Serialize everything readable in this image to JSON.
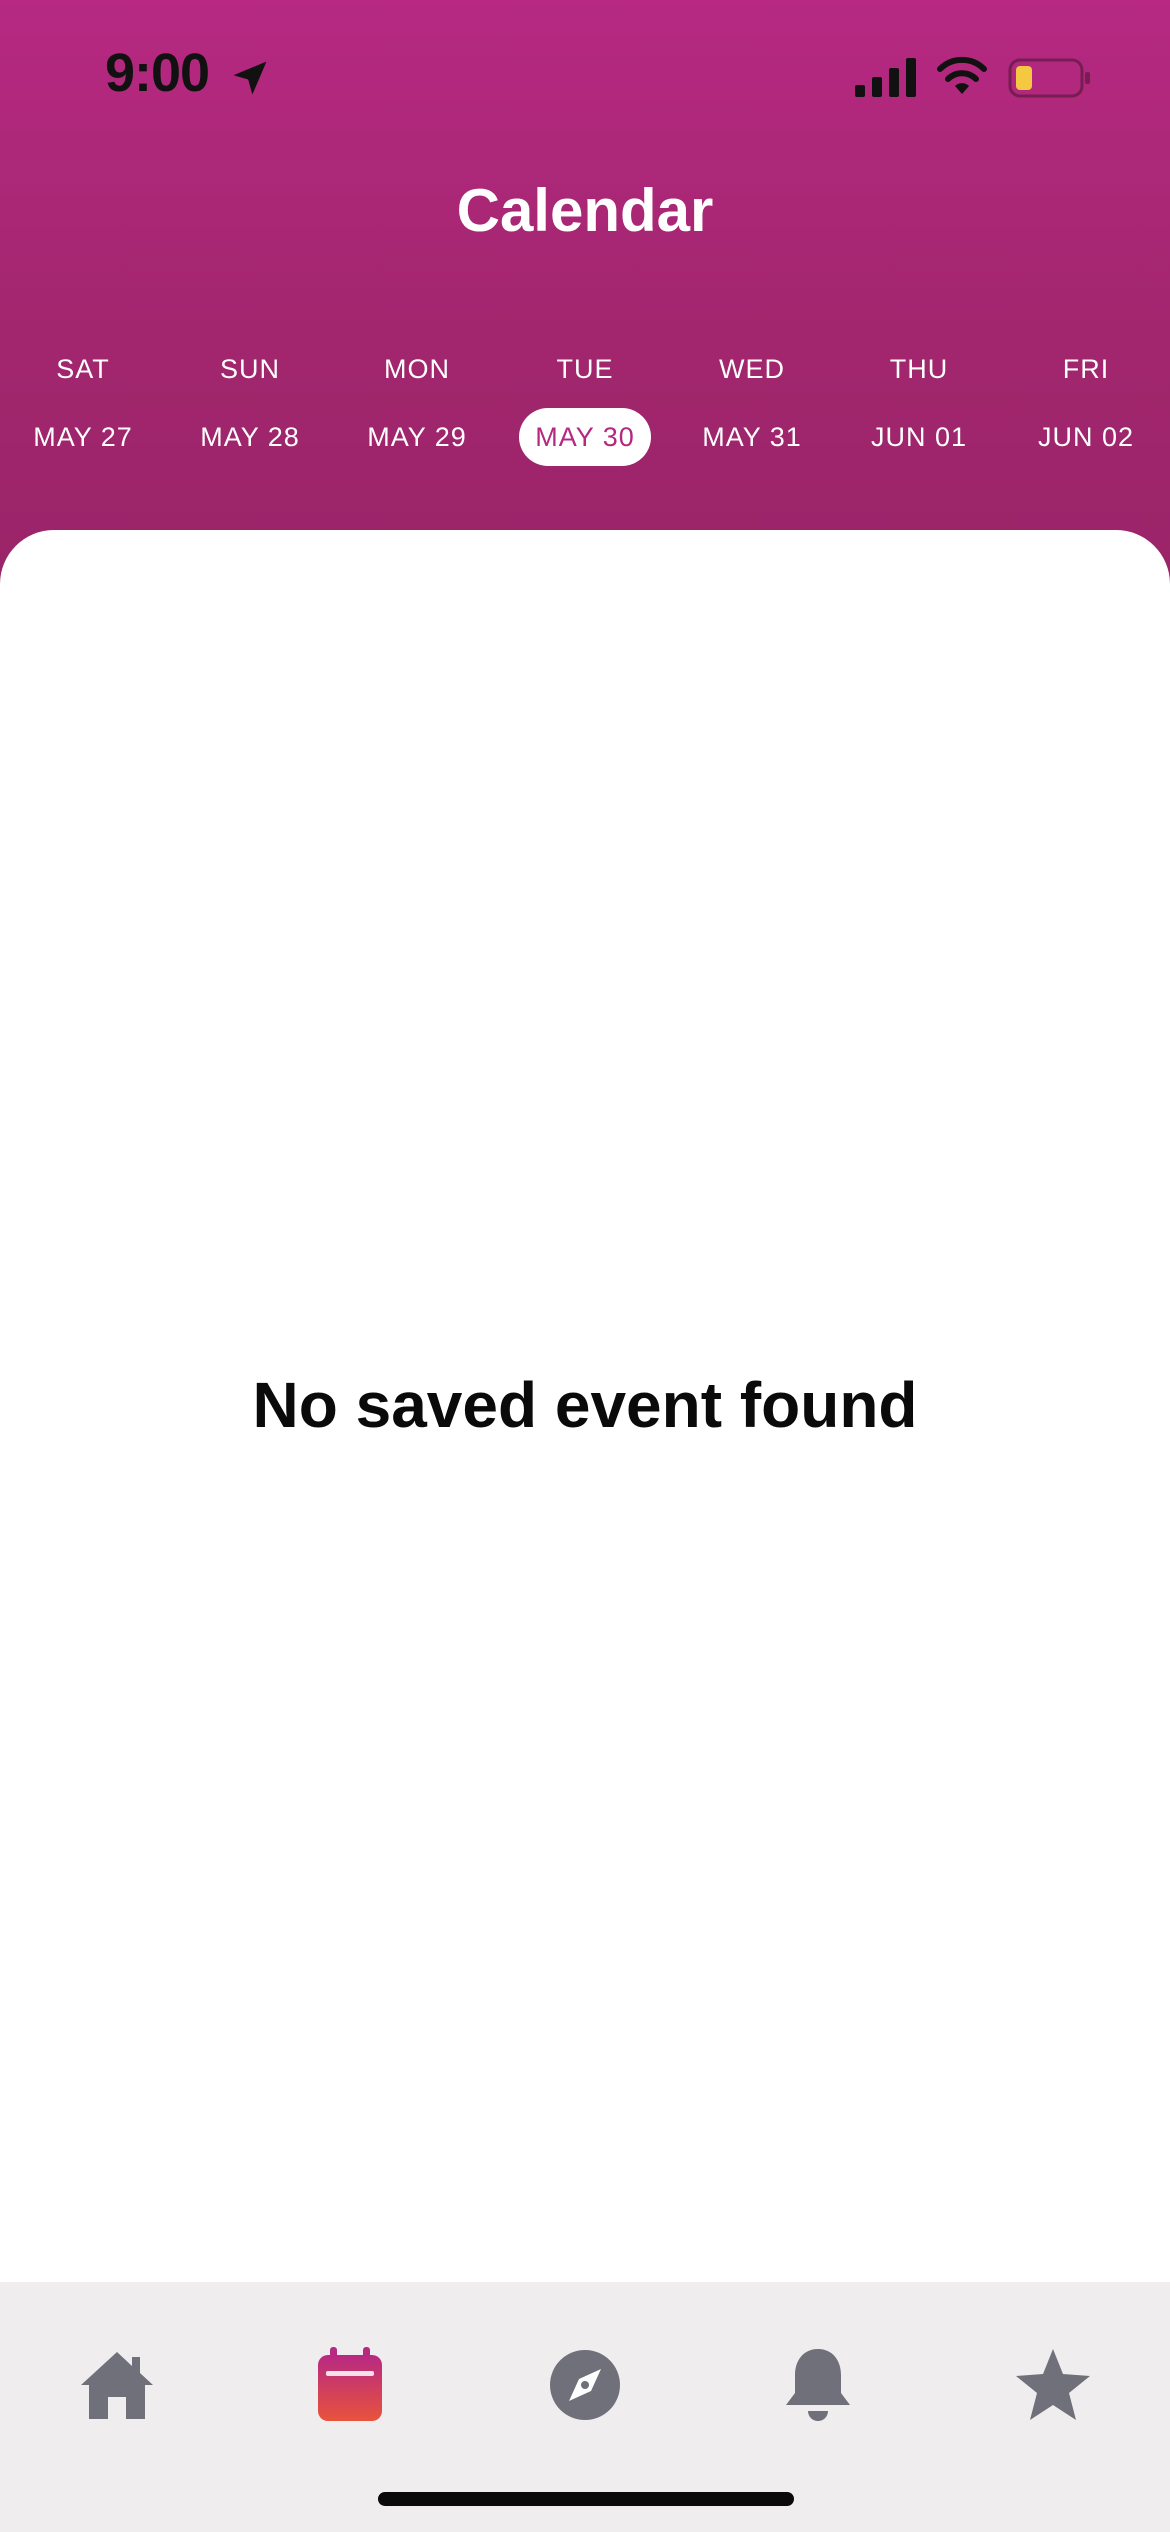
{
  "status_bar": {
    "time": "9:00",
    "icons": [
      "location-arrow-icon",
      "cellular-signal-icon",
      "wifi-icon",
      "battery-low-icon"
    ],
    "battery_color": "#f5c842"
  },
  "header": {
    "title": "Calendar",
    "gradient_top": "#b72983",
    "gradient_bottom": "#9a2468"
  },
  "days": [
    {
      "dow": "SAT",
      "date": "MAY 27",
      "selected": false
    },
    {
      "dow": "SUN",
      "date": "MAY 28",
      "selected": false
    },
    {
      "dow": "MON",
      "date": "MAY 29",
      "selected": false
    },
    {
      "dow": "TUE",
      "date": "MAY 30",
      "selected": true
    },
    {
      "dow": "WED",
      "date": "MAY 31",
      "selected": false
    },
    {
      "dow": "THU",
      "date": "JUN 01",
      "selected": false
    },
    {
      "dow": "FRI",
      "date": "JUN 02",
      "selected": false
    }
  ],
  "main": {
    "empty_message": "No saved event found"
  },
  "tabbar": {
    "tabs": [
      {
        "name": "home",
        "icon": "home-icon",
        "active": false
      },
      {
        "name": "calendar",
        "icon": "calendar-icon",
        "active": true
      },
      {
        "name": "explore",
        "icon": "compass-icon",
        "active": false
      },
      {
        "name": "notifications",
        "icon": "bell-icon",
        "active": false
      },
      {
        "name": "favorites",
        "icon": "star-icon",
        "active": false
      }
    ],
    "inactive_color": "#6f7079",
    "active_gradient": [
      "#b72983",
      "#e8533c"
    ]
  }
}
